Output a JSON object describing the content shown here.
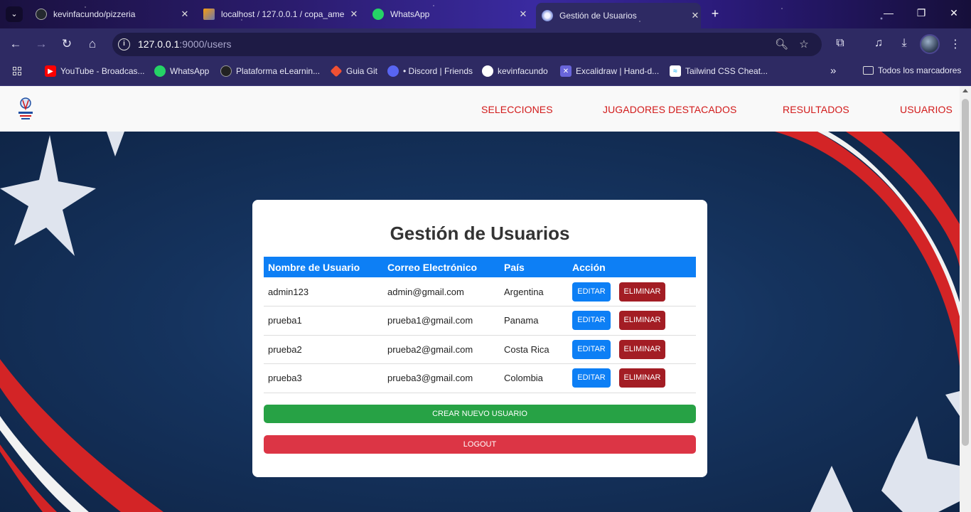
{
  "browser": {
    "tabs": [
      {
        "title": "kevinfacundo/pizzeria",
        "icon": "github-icon"
      },
      {
        "title": "localhost / 127.0.0.1 / copa_ame",
        "icon": "phpmyadmin-icon"
      },
      {
        "title": "WhatsApp",
        "icon": "whatsapp-icon"
      },
      {
        "title": "Gestión de Usuarios",
        "icon": "globe-icon",
        "active": true
      }
    ],
    "url_host": "127.0.0.1",
    "url_path": ":9000/users",
    "bookmarks": [
      {
        "label": "YouTube - Broadcas...",
        "icon": "youtube-icon",
        "color": "#ff0000"
      },
      {
        "label": "WhatsApp",
        "icon": "whatsapp-icon",
        "color": "#25d366"
      },
      {
        "label": "Plataforma eLearnin...",
        "icon": "elearning-icon",
        "color": "#222222"
      },
      {
        "label": "Guia Git",
        "icon": "git-icon",
        "color": "#f05033"
      },
      {
        "label": "• Discord | Friends",
        "icon": "discord-icon",
        "color": "#5865f2"
      },
      {
        "label": "kevinfacundo",
        "icon": "github-icon",
        "color": "#ffffff"
      },
      {
        "label": "Excalidraw | Hand-d...",
        "icon": "excalidraw-icon",
        "color": "#6965db"
      },
      {
        "label": "Tailwind CSS Cheat...",
        "icon": "tailwind-icon",
        "color": "#ffffff"
      }
    ],
    "all_bookmarks_label": "Todos los marcadores"
  },
  "site": {
    "nav": [
      "SELECCIONES",
      "JUGADORES DESTACADOS",
      "RESULTADOS",
      "USUARIOS"
    ]
  },
  "page": {
    "title": "Gestión de Usuarios",
    "columns": [
      "Nombre de Usuario",
      "Correo Electrónico",
      "País",
      "Acción"
    ],
    "users": [
      {
        "username": "admin123",
        "email": "admin@gmail.com",
        "country": "Argentina"
      },
      {
        "username": "prueba1",
        "email": "prueba1@gmail.com",
        "country": "Panama"
      },
      {
        "username": "prueba2",
        "email": "prueba2@gmail.com",
        "country": "Costa Rica"
      },
      {
        "username": "prueba3",
        "email": "prueba3@gmail.com",
        "country": "Colombia"
      }
    ],
    "edit_label": "EDITAR",
    "delete_label": "ELIMINAR",
    "create_label": "CREAR NUEVO USUARIO",
    "logout_label": "LOGOUT"
  },
  "colors": {
    "accent_blue": "#0d7ff5",
    "delete_red": "#a31d24",
    "create_green": "#27a245",
    "logout_red": "#dc3545",
    "nav_red": "#d21a1a"
  }
}
